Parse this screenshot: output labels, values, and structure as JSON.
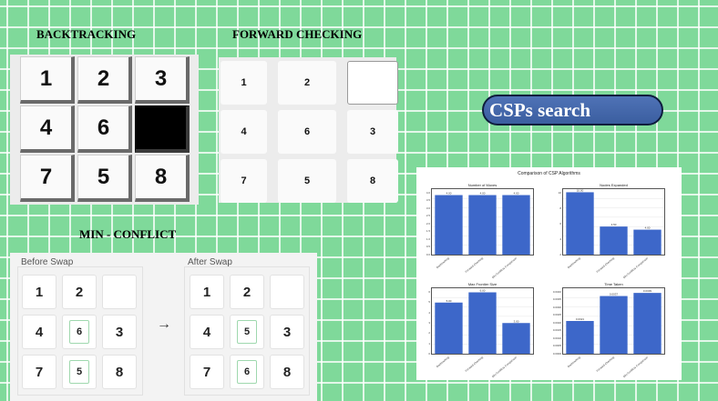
{
  "headings": {
    "backtracking": "BACKTRACKING",
    "forward_checking": "FORWARD CHECKING",
    "min_conflict": "MIN - CONFLICT"
  },
  "backtracking_board": [
    "1",
    "2",
    "3",
    "4",
    "6",
    "",
    "7",
    "5",
    "8"
  ],
  "forward_checking_board": [
    "1",
    "2",
    "",
    "4",
    "6",
    "3",
    "7",
    "5",
    "8"
  ],
  "min_conflict": {
    "before_label": "Before Swap",
    "after_label": "After Swap",
    "arrow": "→",
    "before_board": [
      "1",
      "2",
      "",
      "4",
      "6",
      "3",
      "7",
      "5",
      "8"
    ],
    "after_board": [
      "1",
      "2",
      "",
      "4",
      "5",
      "3",
      "7",
      "6",
      "8"
    ]
  },
  "pill_label": "CSPs search",
  "chart_data": [
    {
      "type": "bar",
      "title": "Number of Moves",
      "categories": [
        "Backtracking",
        "Forward Checking",
        "Min-Conflicts Comparison"
      ],
      "values": [
        4.0,
        4.0,
        4.0
      ],
      "value_labels": [
        "4.00",
        "4.00",
        "4.00"
      ],
      "ylim": [
        0,
        4.4
      ],
      "yticks": [
        "0.0",
        "0.5",
        "1.0",
        "1.5",
        "2.0",
        "2.5",
        "3.0",
        "3.5",
        "4.0"
      ],
      "ylabel": "Count",
      "color": "#3d67c9"
    },
    {
      "type": "bar",
      "title": "Nodes Expanded",
      "categories": [
        "Backtracking",
        "Forward Checking",
        "Min-Conflicts Comparison"
      ],
      "values": [
        10.0,
        4.5,
        4.0
      ],
      "value_labels": [
        "10.00",
        "4.50",
        "4.00"
      ],
      "ylim": [
        0,
        10.5
      ],
      "yticks": [
        "2",
        "4",
        "6",
        "8",
        "10"
      ],
      "color": "#3d67c9"
    },
    {
      "type": "bar",
      "title": "Max Frontier Size",
      "categories": [
        "Backtracking",
        "Forward Checking",
        "Min-Conflicts Comparison"
      ],
      "values": [
        5.0,
        6.0,
        3.0
      ],
      "value_labels": [
        "5.00",
        "6.00",
        "3.00"
      ],
      "ylim": [
        0,
        6.4
      ],
      "yticks": [
        "0",
        "1",
        "2",
        "3",
        "4",
        "5",
        "6"
      ],
      "ylabel": "Count",
      "color": "#3d67c9"
    },
    {
      "type": "bar",
      "title": "Time Taken",
      "categories": [
        "Backtracking",
        "Forward Checking",
        "Min-Conflicts Comparison"
      ],
      "values": [
        0.0021,
        0.0037,
        0.0039
      ],
      "value_labels": [
        "0.0021",
        "0.0037",
        "0.0039"
      ],
      "ylim": [
        0,
        0.0042
      ],
      "yticks": [
        "0.0000",
        "0.0005",
        "0.0010",
        "0.0015",
        "0.0020",
        "0.0025",
        "0.0030",
        "0.0035",
        "0.0040"
      ],
      "ylabel": "Time (s)",
      "color": "#3d67c9"
    }
  ],
  "chart_title": "Comparison of CSP Algorithms",
  "colors": {
    "background": "#7fd99a",
    "grid_line": "#ffffff",
    "pill": "#4466aa",
    "bar": "#3d67c9"
  }
}
